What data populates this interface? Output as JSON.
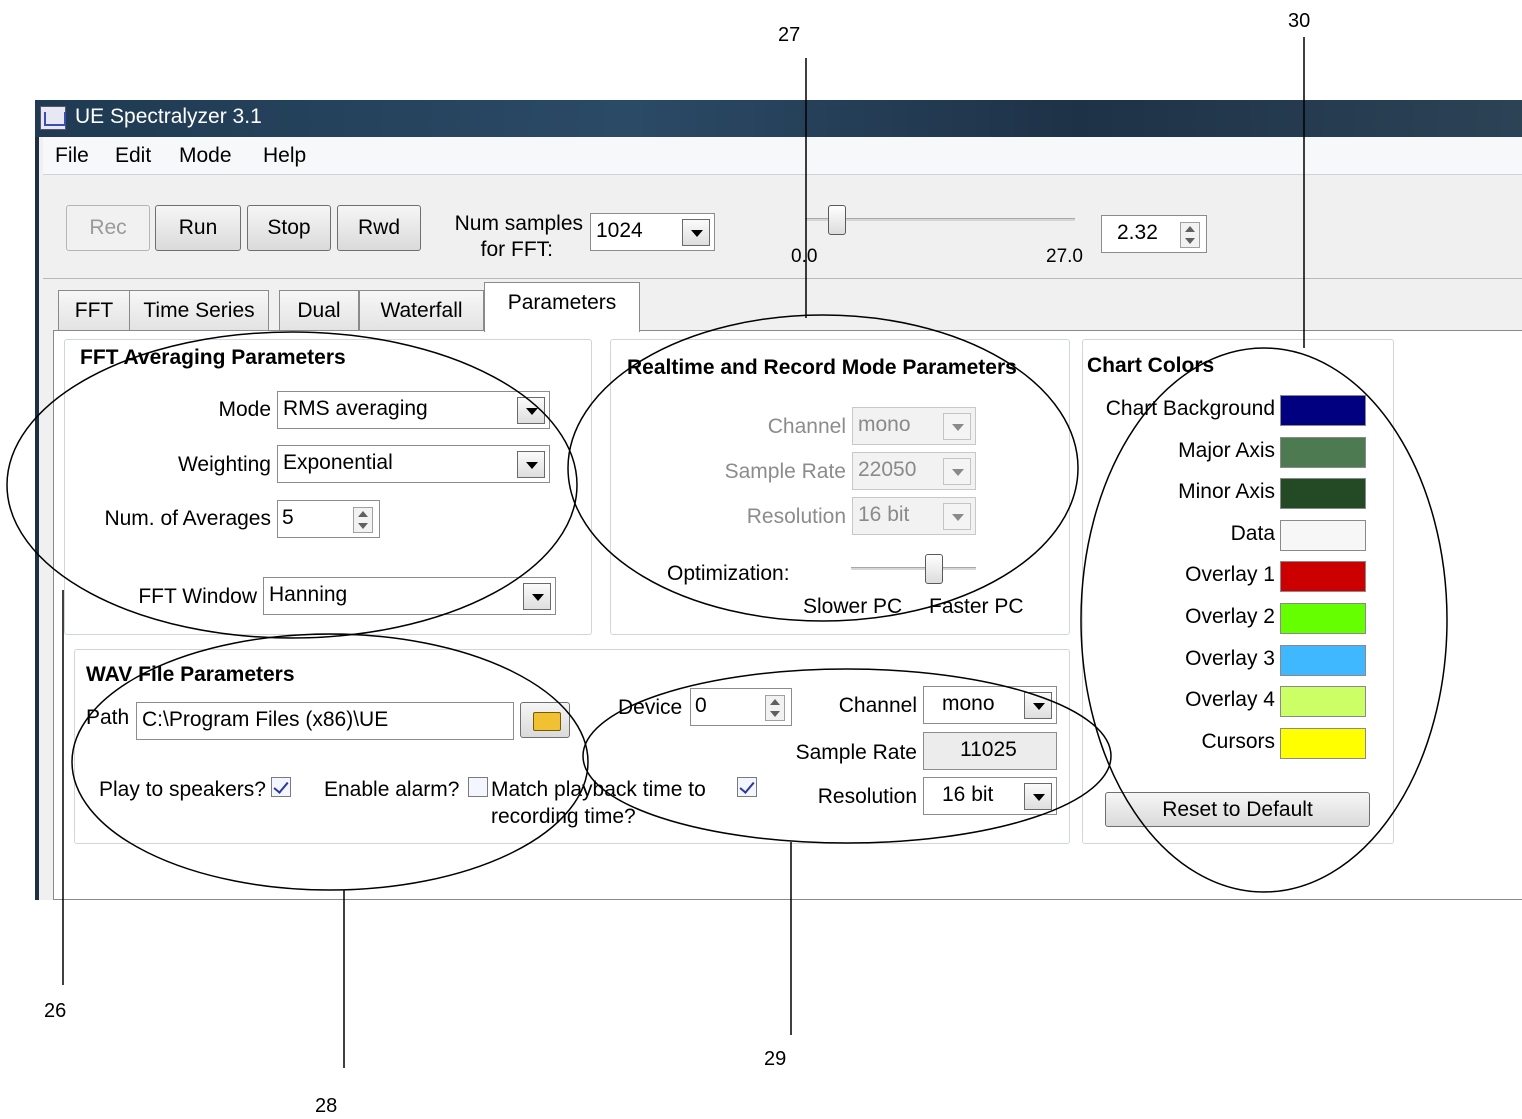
{
  "callouts": {
    "c27": "27",
    "c30": "30",
    "c26": "26",
    "c28": "28",
    "c29": "29"
  },
  "window": {
    "title": "UE Spectralyzer 3.1"
  },
  "menu": [
    "File",
    "Edit",
    "Mode",
    "Help"
  ],
  "toolbar": {
    "rec": "Rec",
    "run": "Run",
    "stop": "Stop",
    "rwd": "Rwd",
    "num_samples_label_1": "Num samples",
    "num_samples_label_2": "for FFT:",
    "num_samples_value": "1024",
    "slider_min": "0.0",
    "slider_max": "27.0",
    "slider_level": 2.32,
    "spin_value": "2.32"
  },
  "tabs": [
    "FFT",
    "Time Series",
    "Dual",
    "Waterfall",
    "Parameters"
  ],
  "fft_avg": {
    "title": "FFT Averaging Parameters",
    "mode_label": "Mode",
    "mode_value": "RMS averaging",
    "weighting_label": "Weighting",
    "weighting_value": "Exponential",
    "num_avg_label": "Num. of Averages",
    "num_avg_value": "5",
    "window_label": "FFT Window",
    "window_value": "Hanning"
  },
  "realtime": {
    "title": "Realtime and Record Mode Parameters",
    "channel_label": "Channel",
    "channel_value": "mono",
    "rate_label": "Sample Rate",
    "rate_value": "22050",
    "res_label": "Resolution",
    "res_value": "16 bit",
    "opt_label": "Optimization:",
    "slower": "Slower PC",
    "faster": "Faster PC"
  },
  "wav": {
    "title": "WAV File Parameters",
    "path_label": "Path",
    "path_value": "C:\\Program Files (x86)\\UE",
    "device_label": "Device",
    "device_value": "0",
    "channel_label": "Channel",
    "channel_value": "mono",
    "rate_label": "Sample Rate",
    "rate_value": "11025",
    "res_label": "Resolution",
    "res_value": "16 bit",
    "play_label": "Play to speakers?",
    "alarm_label": "Enable alarm?",
    "match_label_1": "Match playback time to",
    "match_label_2": "recording time?"
  },
  "colors": {
    "title": "Chart Colors",
    "items": [
      {
        "label": "Chart Background",
        "color": "#000080"
      },
      {
        "label": "Major Axis",
        "color": "#4e7a52"
      },
      {
        "label": "Minor Axis",
        "color": "#234a25"
      },
      {
        "label": "Data",
        "color": "#f7f7f7"
      },
      {
        "label": "Overlay 1",
        "color": "#cc0000"
      },
      {
        "label": "Overlay 2",
        "color": "#66ff00"
      },
      {
        "label": "Overlay 3",
        "color": "#3fb8ff"
      },
      {
        "label": "Overlay 4",
        "color": "#ccff66"
      },
      {
        "label": "Cursors",
        "color": "#ffff00"
      }
    ],
    "reset": "Reset to Default"
  }
}
